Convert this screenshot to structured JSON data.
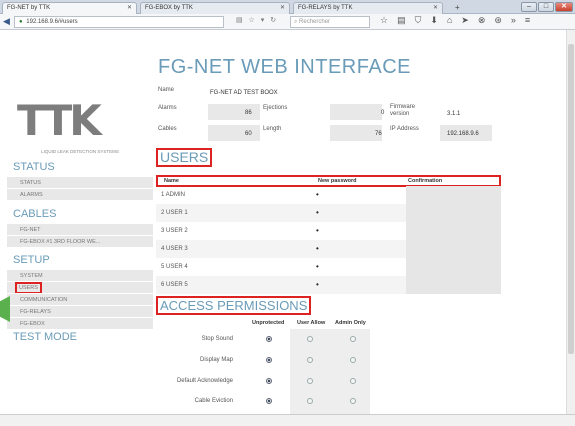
{
  "browser": {
    "tabs": [
      {
        "label": "FG-NET by TTK"
      },
      {
        "label": "FG-EBOX by TTK"
      },
      {
        "label": "FG-RELAYS by TTK"
      }
    ],
    "new_tab": "+",
    "url": "192.168.9.6/#users",
    "search_placeholder": "Rechercher"
  },
  "sidebar": {
    "logo": "TTK",
    "tagline": "LIQUID LEAK DETECTION SYSTEMS",
    "sections": [
      {
        "label": "STATUS",
        "items": [
          "STATUS",
          "ALARMS"
        ]
      },
      {
        "label": "CABLES",
        "items": [
          "FG-NET",
          "FG-EBOX #1 3RD FLOOR WE..."
        ]
      },
      {
        "label": "SETUP",
        "items": [
          "SYSTEM",
          "USERS",
          "COMMUNICATION",
          "FG-RELAYS",
          "FG-EBOX"
        ]
      },
      {
        "label": "TEST MODE",
        "items": []
      }
    ]
  },
  "main": {
    "title": "FG-NET WEB INTERFACE",
    "info": {
      "name_label": "Name",
      "name_value": "FG-NET AD TEST BOOX",
      "alarms_label": "Alarms",
      "alarms_value": "86",
      "ejections_label": "Ejections",
      "ejections_value": "0",
      "firmware_label": "Firmware version",
      "firmware_value": "3.1.1",
      "cables_label": "Cables",
      "cables_value": "60",
      "length_label": "Length",
      "length_value": "76",
      "ip_label": "IP Address",
      "ip_value": "192.168.9.6"
    },
    "users": {
      "heading": "USERS",
      "columns": [
        "Name",
        "New password",
        "Confirmation"
      ],
      "rows": [
        "1 ADMIN",
        "2 USER 1",
        "3 USER 2",
        "4 USER 3",
        "5 USER 4",
        "6 USER 5"
      ],
      "password_mask": "•"
    },
    "permissions": {
      "heading": "ACCESS PERMISSIONS",
      "columns": [
        "Unprotected",
        "User Allow",
        "Admin Only"
      ],
      "rows": [
        {
          "label": "Stop Sound",
          "selected": 0
        },
        {
          "label": "Display Map",
          "selected": 0
        },
        {
          "label": "Default Acknowledge",
          "selected": 0
        },
        {
          "label": "Cable Eviction",
          "selected": 0
        }
      ]
    }
  }
}
